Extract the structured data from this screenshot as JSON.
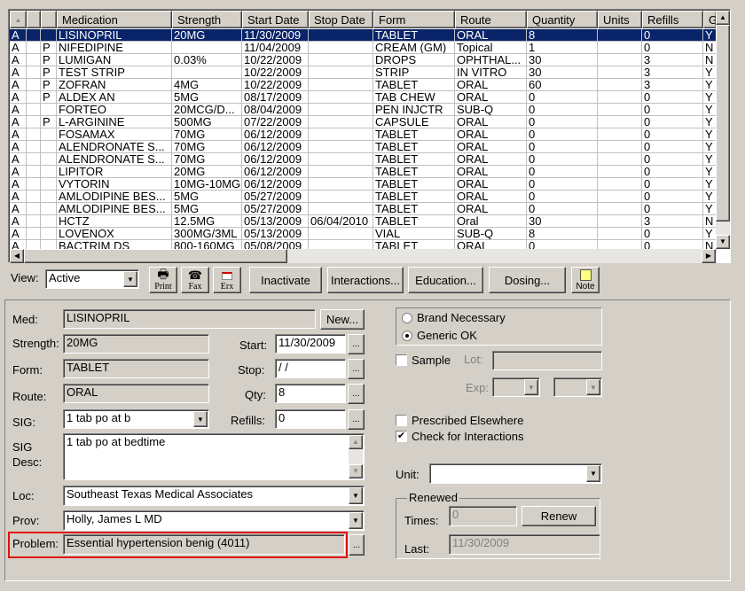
{
  "grid": {
    "columns": [
      "",
      "",
      "",
      "Medication",
      "Strength",
      "Start Date",
      "Stop Date",
      "Form",
      "Route",
      "Quantity",
      "Units",
      "Refills",
      "G"
    ],
    "rows": [
      [
        "A",
        "",
        "",
        "LISINOPRIL",
        "20MG",
        "11/30/2009",
        "",
        "TABLET",
        "ORAL",
        "8",
        "",
        "0",
        "Y"
      ],
      [
        "A",
        "",
        "P",
        "NIFEDIPINE",
        "",
        "11/04/2009",
        "",
        "CREAM (GM)",
        "Topical",
        "1",
        "",
        "0",
        "N"
      ],
      [
        "A",
        "",
        "P",
        "LUMIGAN",
        "0.03%",
        "10/22/2009",
        "",
        "DROPS",
        "OPHTHAL...",
        "30",
        "",
        "3",
        "N"
      ],
      [
        "A",
        "",
        "P",
        "TEST STRIP",
        "",
        "10/22/2009",
        "",
        "STRIP",
        "IN VITRO",
        "30",
        "",
        "3",
        "Y"
      ],
      [
        "A",
        "",
        "P",
        "ZOFRAN",
        "4MG",
        "10/22/2009",
        "",
        "TABLET",
        "ORAL",
        "60",
        "",
        "3",
        "Y"
      ],
      [
        "A",
        "",
        "P",
        "ALDEX AN",
        "5MG",
        "08/17/2009",
        "",
        "TAB CHEW",
        "ORAL",
        "0",
        "",
        "0",
        "Y"
      ],
      [
        "A",
        "",
        "",
        "FORTEO",
        "20MCG/D...",
        "08/04/2009",
        "",
        "PEN INJCTR",
        "SUB-Q",
        "0",
        "",
        "0",
        "Y"
      ],
      [
        "A",
        "",
        "P",
        "L-ARGININE",
        "500MG",
        "07/22/2009",
        "",
        "CAPSULE",
        "ORAL",
        "0",
        "",
        "0",
        "Y"
      ],
      [
        "A",
        "",
        "",
        "FOSAMAX",
        "70MG",
        "06/12/2009",
        "",
        "TABLET",
        "ORAL",
        "0",
        "",
        "0",
        "Y"
      ],
      [
        "A",
        "",
        "",
        "ALENDRONATE S...",
        "70MG",
        "06/12/2009",
        "",
        "TABLET",
        "ORAL",
        "0",
        "",
        "0",
        "Y"
      ],
      [
        "A",
        "",
        "",
        "ALENDRONATE S...",
        "70MG",
        "06/12/2009",
        "",
        "TABLET",
        "ORAL",
        "0",
        "",
        "0",
        "Y"
      ],
      [
        "A",
        "",
        "",
        "LIPITOR",
        "20MG",
        "06/12/2009",
        "",
        "TABLET",
        "ORAL",
        "0",
        "",
        "0",
        "Y"
      ],
      [
        "A",
        "",
        "",
        "VYTORIN",
        "10MG-10MG",
        "06/12/2009",
        "",
        "TABLET",
        "ORAL",
        "0",
        "",
        "0",
        "Y"
      ],
      [
        "A",
        "",
        "",
        "AMLODIPINE BES...",
        "5MG",
        "05/27/2009",
        "",
        "TABLET",
        "ORAL",
        "0",
        "",
        "0",
        "Y"
      ],
      [
        "A",
        "",
        "",
        "AMLODIPINE BES...",
        "5MG",
        "05/27/2009",
        "",
        "TABLET",
        "ORAL",
        "0",
        "",
        "0",
        "Y"
      ],
      [
        "A",
        "",
        "",
        "HCTZ",
        "12.5MG",
        "05/13/2009",
        "06/04/2010",
        "TABLET",
        "Oral",
        "30",
        "",
        "3",
        "N"
      ],
      [
        "A",
        "",
        "",
        "LOVENOX",
        "300MG/3ML",
        "05/13/2009",
        "",
        "VIAL",
        "SUB-Q",
        "8",
        "",
        "0",
        "Y"
      ],
      [
        "A",
        "",
        "",
        "BACTRIM DS",
        "800-160MG",
        "05/08/2009",
        "",
        "TABLET",
        "ORAL",
        "0",
        "",
        "0",
        "N"
      ]
    ],
    "selected_row": 0
  },
  "toolbar": {
    "view_label": "View:",
    "view_value": "Active",
    "print": "Print",
    "fax": "Fax",
    "erx": "Erx",
    "inactivate": "Inactivate",
    "interactions": "Interactions...",
    "education": "Education...",
    "dosing": "Dosing...",
    "note": "Note"
  },
  "form": {
    "med_label": "Med:",
    "med": "LISINOPRIL",
    "new": "New...",
    "strength_label": "Strength:",
    "strength": "20MG",
    "form_label": "Form:",
    "form": "TABLET",
    "route_label": "Route:",
    "route": "ORAL",
    "sig_label": "SIG:",
    "sig": "1 tab po at b",
    "sigdesc_label1": "SIG",
    "sigdesc_label2": "Desc:",
    "sigdesc": "1 tab po at bedtime",
    "loc_label": "Loc:",
    "loc": "Southeast Texas Medical Associates",
    "prov_label": "Prov:",
    "prov": "Holly, James  L MD",
    "problem_label": "Problem:",
    "problem": "Essential hypertension benig (4011)",
    "start_label": "Start:",
    "start": "11/30/2009",
    "stop_label": "Stop:",
    "stop": " / /",
    "qty_label": "Qty:",
    "qty": "8",
    "refills_label": "Refills:",
    "refills": "0",
    "ellipsis": "..."
  },
  "right": {
    "brand": "Brand Necessary",
    "generic": "Generic OK",
    "generic_selected": true,
    "sample": "Sample",
    "sample_checked": false,
    "lot_label": "Lot:",
    "exp_label": "Exp:",
    "prescribed_elsewhere": "Prescribed Elsewhere",
    "prescribed_checked": false,
    "check_interactions": "Check for Interactions",
    "check_interactions_checked": true,
    "unit_label": "Unit:",
    "unit": "",
    "renewed_title": "Renewed",
    "times_label": "Times:",
    "times": "0",
    "renew": "Renew",
    "last_label": "Last:",
    "last": "11/30/2009"
  },
  "colors": {
    "selection": "#0a246a",
    "highlight_box": "#e01010",
    "face": "#d4d0c8"
  }
}
